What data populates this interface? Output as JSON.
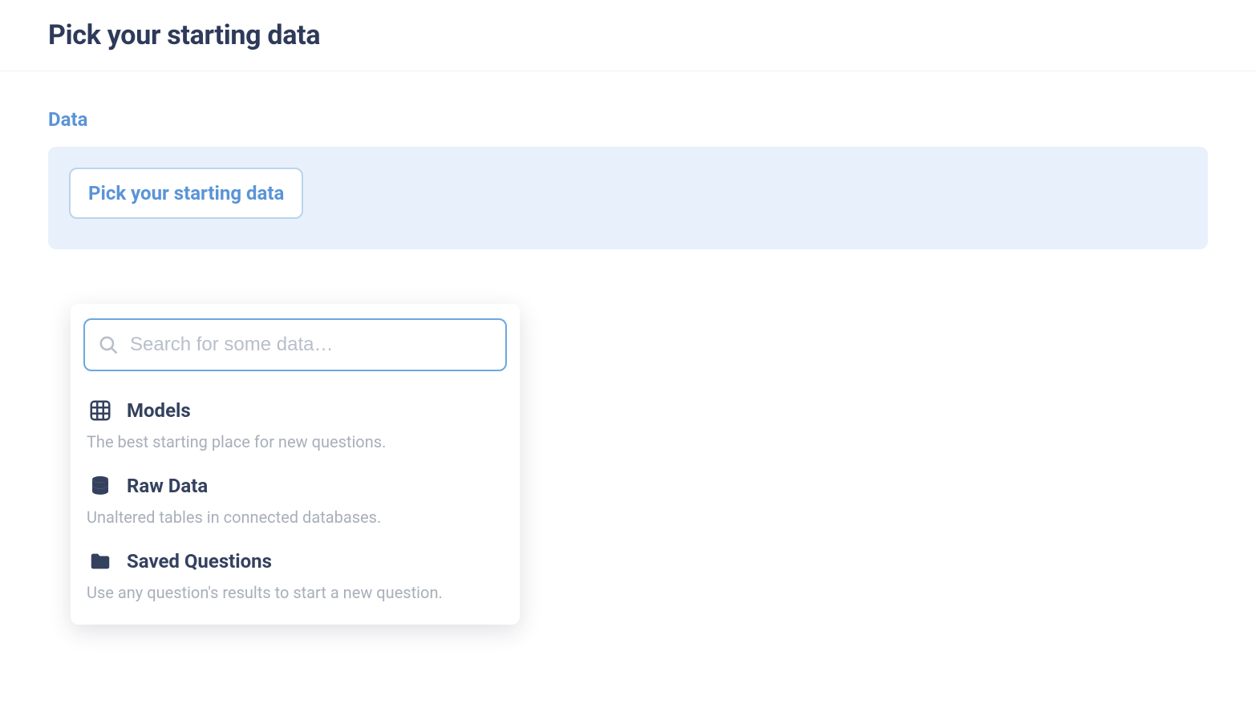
{
  "header": {
    "title": "Pick your starting data"
  },
  "section": {
    "label": "Data",
    "pick_button_label": "Pick your starting data"
  },
  "search": {
    "placeholder": "Search for some data…",
    "value": ""
  },
  "options": [
    {
      "icon": "table-icon",
      "title": "Models",
      "description": "The best starting place for new questions."
    },
    {
      "icon": "database-icon",
      "title": "Raw Data",
      "description": "Unaltered tables in connected databases."
    },
    {
      "icon": "folder-icon",
      "title": "Saved Questions",
      "description": "Use any question's results to start a new question."
    }
  ]
}
